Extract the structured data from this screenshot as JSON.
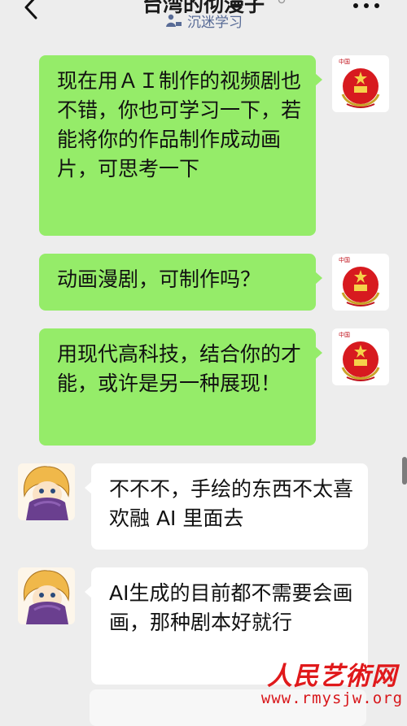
{
  "header": {
    "title": "台湾的彻漫子",
    "subtitle": "沉迷学习",
    "back_icon": "chevron-left-icon",
    "more_icon": "more-dots-icon"
  },
  "messages": [
    {
      "side": "me",
      "text": "现在用ＡＩ制作的视频剧也不错，你也可学习一下，若能将你的作品制作成动画片，可思考一下"
    },
    {
      "side": "me",
      "text": "动画漫剧，可制作吗？"
    },
    {
      "side": "me",
      "text": "用现代高科技，结合你的才能，或许是另一种展现！"
    },
    {
      "side": "them",
      "text": "不不不，手绘的东西不太喜欢融 AI 里面去"
    },
    {
      "side": "them",
      "text": "AI生成的目前都不需要会画画，那种剧本好就行"
    }
  ],
  "watermark": {
    "name": "人民艺術网",
    "url": "www.rmysjw.org"
  },
  "colors": {
    "background": "#ededed",
    "my_bubble": "#95ec69",
    "their_bubble": "#ffffff",
    "subtitle": "#586b96",
    "watermark": "#e0191b"
  }
}
